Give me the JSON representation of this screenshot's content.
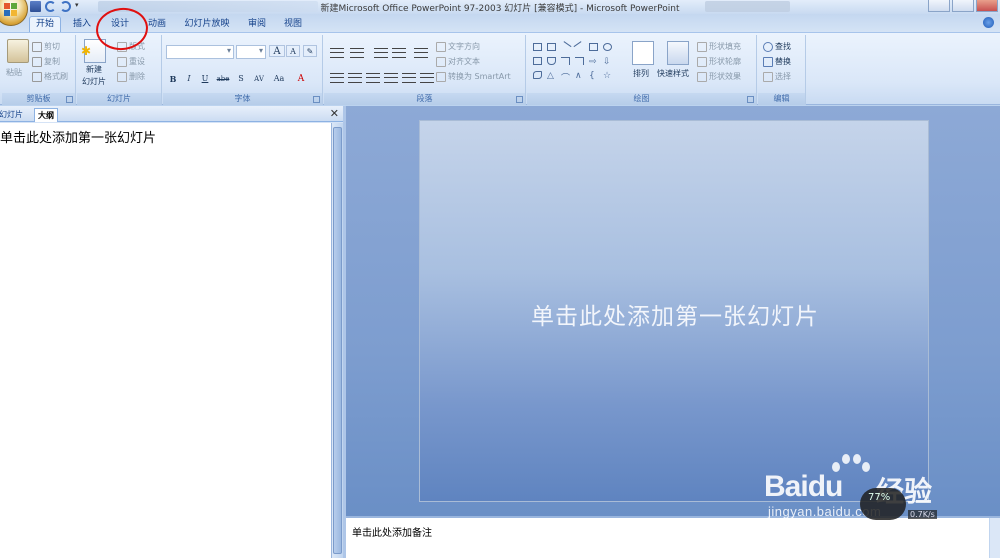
{
  "window": {
    "title": "新建Microsoft Office PowerPoint 97-2003 幻灯片 [兼容模式] - Microsoft PowerPoint"
  },
  "tabs": [
    {
      "label": "开始",
      "active": true
    },
    {
      "label": "插入",
      "active": false
    },
    {
      "label": "设计",
      "active": false
    },
    {
      "label": "动画",
      "active": false
    },
    {
      "label": "幻灯片放映",
      "active": false
    },
    {
      "label": "审阅",
      "active": false
    },
    {
      "label": "视图",
      "active": false
    }
  ],
  "ribbon": {
    "clipboard": {
      "label": "剪贴板",
      "paste": "粘贴",
      "cut": "剪切",
      "copy": "复制",
      "format_painter": "格式刷"
    },
    "slides": {
      "label": "幻灯片",
      "new_slide_line1": "新建",
      "new_slide_line2": "幻灯片",
      "layout": "版式",
      "reset": "重设",
      "delete": "删除"
    },
    "font": {
      "label": "字体",
      "bold": "B",
      "italic": "I",
      "underline": "U",
      "strike": "abe",
      "shadow": "S",
      "spacing": "AV",
      "case": "Aa",
      "grow": "A",
      "shrink": "A"
    },
    "paragraph": {
      "label": "段落",
      "text_direction": "文字方向",
      "align_text": "对齐文本",
      "convert_smartart": "转换为 SmartArt"
    },
    "drawing": {
      "label": "绘图",
      "arrange": "排列",
      "quick_styles": "快速样式",
      "shape_fill": "形状填充",
      "shape_outline": "形状轮廓",
      "shape_effects": "形状效果"
    },
    "editing": {
      "label": "编辑",
      "find": "查找",
      "replace": "替换",
      "select": "选择"
    }
  },
  "left_pane": {
    "tab_slides": "幻灯片",
    "tab_outline": "大纲",
    "outline_text": "单击此处添加第一张幻灯片"
  },
  "slide": {
    "title_placeholder": "单击此处添加第一张幻灯片"
  },
  "notes": {
    "placeholder": "单击此处添加备注"
  },
  "watermark": {
    "brand": "Bai",
    "brand_du": "du",
    "product": "经验",
    "url": "jingyan.baidu.com"
  },
  "perf_gauge": {
    "percent": "77%",
    "rate": "0.7K/s"
  },
  "colors": {
    "ribbon_bg": "#dae7f8",
    "slide_bg_top": "#c5d4ea",
    "slide_bg_bottom": "#5f84c0",
    "annotation": "#e01010"
  }
}
